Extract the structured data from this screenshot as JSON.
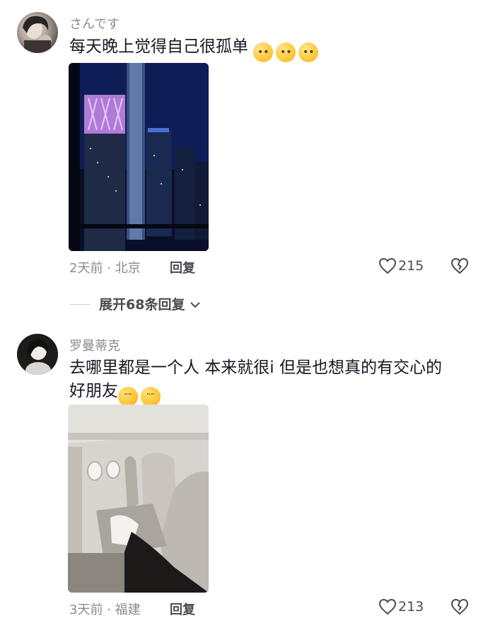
{
  "comments": [
    {
      "username": "さんです",
      "text": "每天晚上觉得自己很孤单",
      "emojis": [
        "pleading-face",
        "pleading-face",
        "pleading-face"
      ],
      "meta": "2天前 · 北京",
      "reply_label": "回复",
      "likes": "215",
      "photo": "night city skyline through window"
    },
    {
      "username": "罗曼蒂克",
      "text_line1": "去哪里都是一个人 本来就很i 但是也想真的有交心的",
      "text_line2": "好朋友",
      "emojis": [
        "loudly-crying-face",
        "loudly-crying-face"
      ],
      "meta": "3天前 · 福建",
      "reply_label": "回复",
      "likes": "213",
      "photo": "empty airplane cabin seats"
    }
  ],
  "expand_replies": "展开68条回复",
  "icons": {
    "heart": "heart-outline-icon",
    "dislike": "broken-heart-icon",
    "chevron": "chevron-down-icon"
  }
}
